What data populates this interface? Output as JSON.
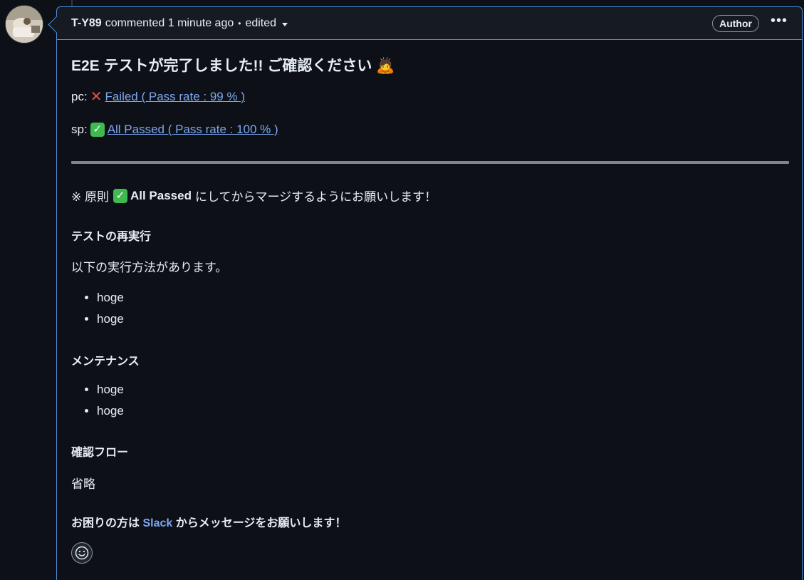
{
  "header": {
    "author": "T-Y89",
    "action": "commented 1 minute ago",
    "separator": "•",
    "edited": "edited",
    "badge": "Author",
    "menu": "•••"
  },
  "body": {
    "title": "E2E テストが完了しました!! ご確認ください 🙇",
    "pc_label": "pc:",
    "pc_link": "Failed ( Pass rate : 99 % )",
    "sp_label": "sp:",
    "sp_link": "All Passed ( Pass rate : 100 % )",
    "note_prefix": "※ 原則",
    "note_bold": "All Passed",
    "note_suffix": "にしてからマージするようにお願いします！",
    "section1_title": "テストの再実行",
    "section1_text": "以下の実行方法があります。",
    "section1_items": [
      "hoge",
      "hoge"
    ],
    "section2_title": "メンテナンス",
    "section2_items": [
      "hoge",
      "hoge"
    ],
    "section3_title": "確認フロー",
    "section3_text": "省略",
    "footer_prefix": "お困りの方は",
    "footer_link": "Slack",
    "footer_suffix": "からメッセージをお願いします！"
  },
  "icons": {
    "fail": "cross-mark-icon",
    "pass": "check-mark-icon",
    "reaction": "smiley-icon"
  },
  "colors": {
    "background": "#0d1117",
    "header_bg": "#161b22",
    "border": "#4c8de0",
    "link": "#7da7f0",
    "fail": "#e5534b",
    "pass": "#3fb950"
  }
}
